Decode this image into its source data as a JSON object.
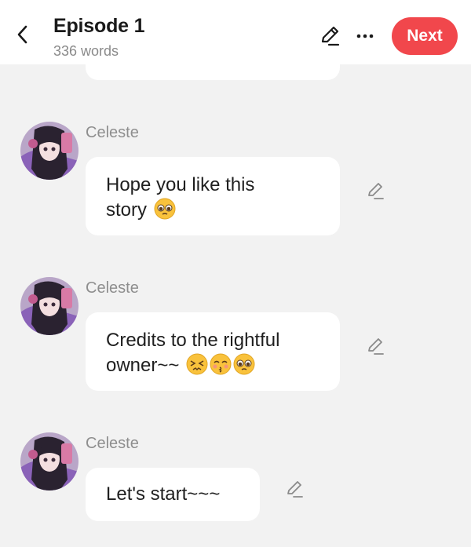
{
  "header": {
    "title": "Episode 1",
    "word_count": "336 words",
    "next_label": "Next",
    "back_icon": "chevron-left-icon",
    "edit_icon": "pencil-icon",
    "more_icon": "more-horizontal-icon"
  },
  "colors": {
    "accent": "#f1474c",
    "background": "#f2f2f2",
    "bubble": "#ffffff",
    "sender_text": "#8e8e8e"
  },
  "messages": [
    {
      "sender": "Celeste",
      "text": "Hope you like this story",
      "lines": [
        "Hope you like this",
        "story"
      ],
      "emojis": [
        "pleading-face"
      ]
    },
    {
      "sender": "Celeste",
      "text": "Credits to the rightful owner~~",
      "lines": [
        "Credits to the rightful",
        "owner~~"
      ],
      "emojis": [
        "persevering-face",
        "kissing-face-closed-eyes",
        "pleading-face"
      ]
    },
    {
      "sender": "Celeste",
      "text": "Let's start~~~",
      "lines": [
        "Let's start~~~"
      ],
      "emojis": []
    }
  ]
}
